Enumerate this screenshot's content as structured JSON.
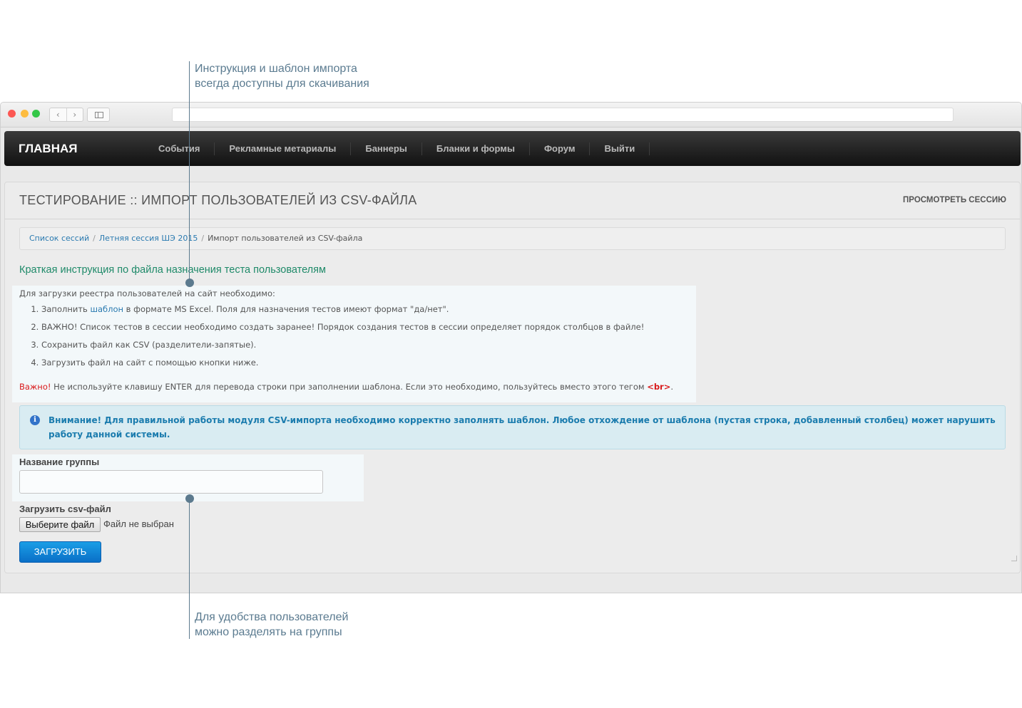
{
  "callouts": {
    "top_line1": "Инструкция и шаблон импорта",
    "top_line2": "всегда доступны для скачивания",
    "bottom_line1": "Для удобства пользователей",
    "bottom_line2": "можно разделять на группы"
  },
  "browser": {
    "traffic_colors": [
      "#fc5753",
      "#fdbc40",
      "#33c748"
    ],
    "back_icon": "‹",
    "forward_icon": "›"
  },
  "navbar": {
    "brand": "ГЛАВНАЯ",
    "items": [
      "События",
      "Рекламные метариалы",
      "Баннеры",
      "Бланки и формы",
      "Форум",
      "Выйти"
    ]
  },
  "panel": {
    "title": "ТЕСТИРОВАНИЕ :: ИМПОРТ ПОЛЬЗОВАТЕЛЕЙ ИЗ CSV-ФАЙЛА",
    "view_session": "ПРОСМОТРЕТЬ СЕССИЮ"
  },
  "breadcrumb": {
    "item1": "Список сессий",
    "item2": "Летняя сессия ШЭ 2015",
    "current": "Импорт пользователей из CSV-файла",
    "separator": "/"
  },
  "instructions": {
    "title": "Краткая инструкция по файла назначения теста пользователям",
    "intro": "Для загрузки реестра пользователей на сайт необходимо:",
    "step1_pre": "Заполнить ",
    "step1_link": "шаблон",
    "step1_post": " в формате MS Excel. Поля для назначения тестов имеют формат \"да/нет\".",
    "step2": "ВАЖНО! Список тестов в сессии необходимо создать заранее! Порядок создания тестов в сессии определяет порядок столбцов в файле!",
    "step3": "Сохранить файл как CSV (разделители-запятые).",
    "step4": "Загрузить файл на сайт с помощью кнопки ниже.",
    "warn_label": "Важно!",
    "warn_text": " Не используйте клавишу ENTER для перевода строки при заполнении шаблона. Если это необходимо, пользуйтесь вместо этого тегом ",
    "warn_tag": "<br>",
    "warn_end": "."
  },
  "alert": {
    "icon": "i",
    "text": "Внимание! Для правильной работы модуля CSV-импорта необходимо корректно заполнять шаблон. Любое отхождение от шаблона (пустая строка, добавленный столбец) может нарушить работу данной системы."
  },
  "form": {
    "group_label": "Название группы",
    "group_value": "",
    "file_label": "Загрузить csv-файл",
    "file_button": "Выберите файл",
    "file_status": "Файл не выбран",
    "submit": "ЗАГРУЗИТЬ"
  }
}
